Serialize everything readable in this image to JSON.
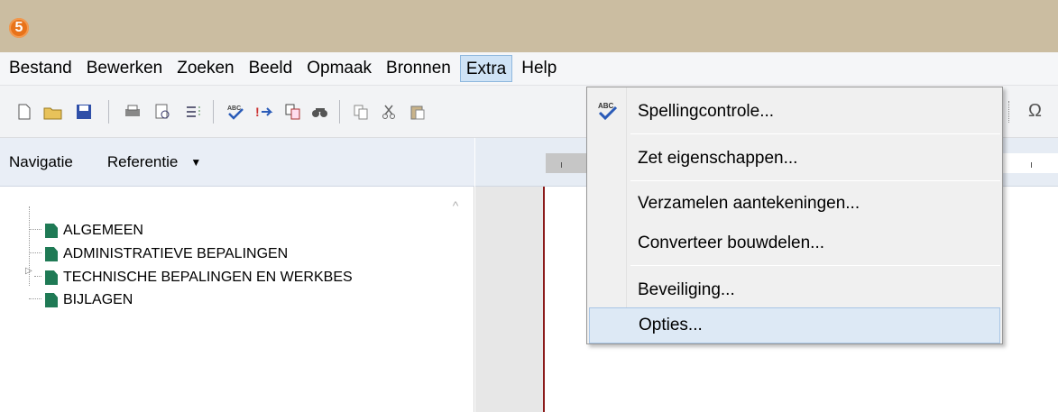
{
  "app": {
    "logo_glyph": "5",
    "logo_color": "#e8731a",
    "title_bar_color": "#cbbda1"
  },
  "menubar": {
    "items": [
      "Bestand",
      "Bewerken",
      "Zoeken",
      "Beeld",
      "Opmaak",
      "Bronnen",
      "Extra",
      "Help"
    ],
    "active": "Extra"
  },
  "toolbar": {
    "icons": [
      "new-document-icon",
      "open-folder-icon",
      "save-icon",
      "print-icon",
      "print-preview-icon",
      "outline-icon",
      "spellcheck-icon",
      "arrow-icon",
      "convert-icon",
      "find-icon",
      "copy-icon",
      "cut-icon",
      "paste-icon",
      "omega-icon"
    ],
    "omega_glyph": "Ω"
  },
  "left_panel": {
    "tab_navigation": "Navigatie",
    "tab_reference": "Referentie",
    "tree": [
      {
        "label": "ALGEMEEN",
        "expandable": false
      },
      {
        "label": "ADMINISTRATIEVE BEPALINGEN",
        "expandable": false
      },
      {
        "label": "TECHNISCHE BEPALINGEN EN WERKBES",
        "expandable": true
      },
      {
        "label": "BIJLAGEN",
        "expandable": false
      }
    ]
  },
  "extra_menu": {
    "items": [
      {
        "label": "Spellingcontrole...",
        "icon": "spellcheck-icon"
      },
      {
        "label": "Zet eigenschappen..."
      },
      {
        "label": "Verzamelen aantekeningen..."
      },
      {
        "label": "Converteer bouwdelen..."
      },
      {
        "label": "Beveiliging..."
      },
      {
        "label": "Opties...",
        "highlighted": true
      }
    ],
    "highlight_color": "#dde9f5"
  }
}
